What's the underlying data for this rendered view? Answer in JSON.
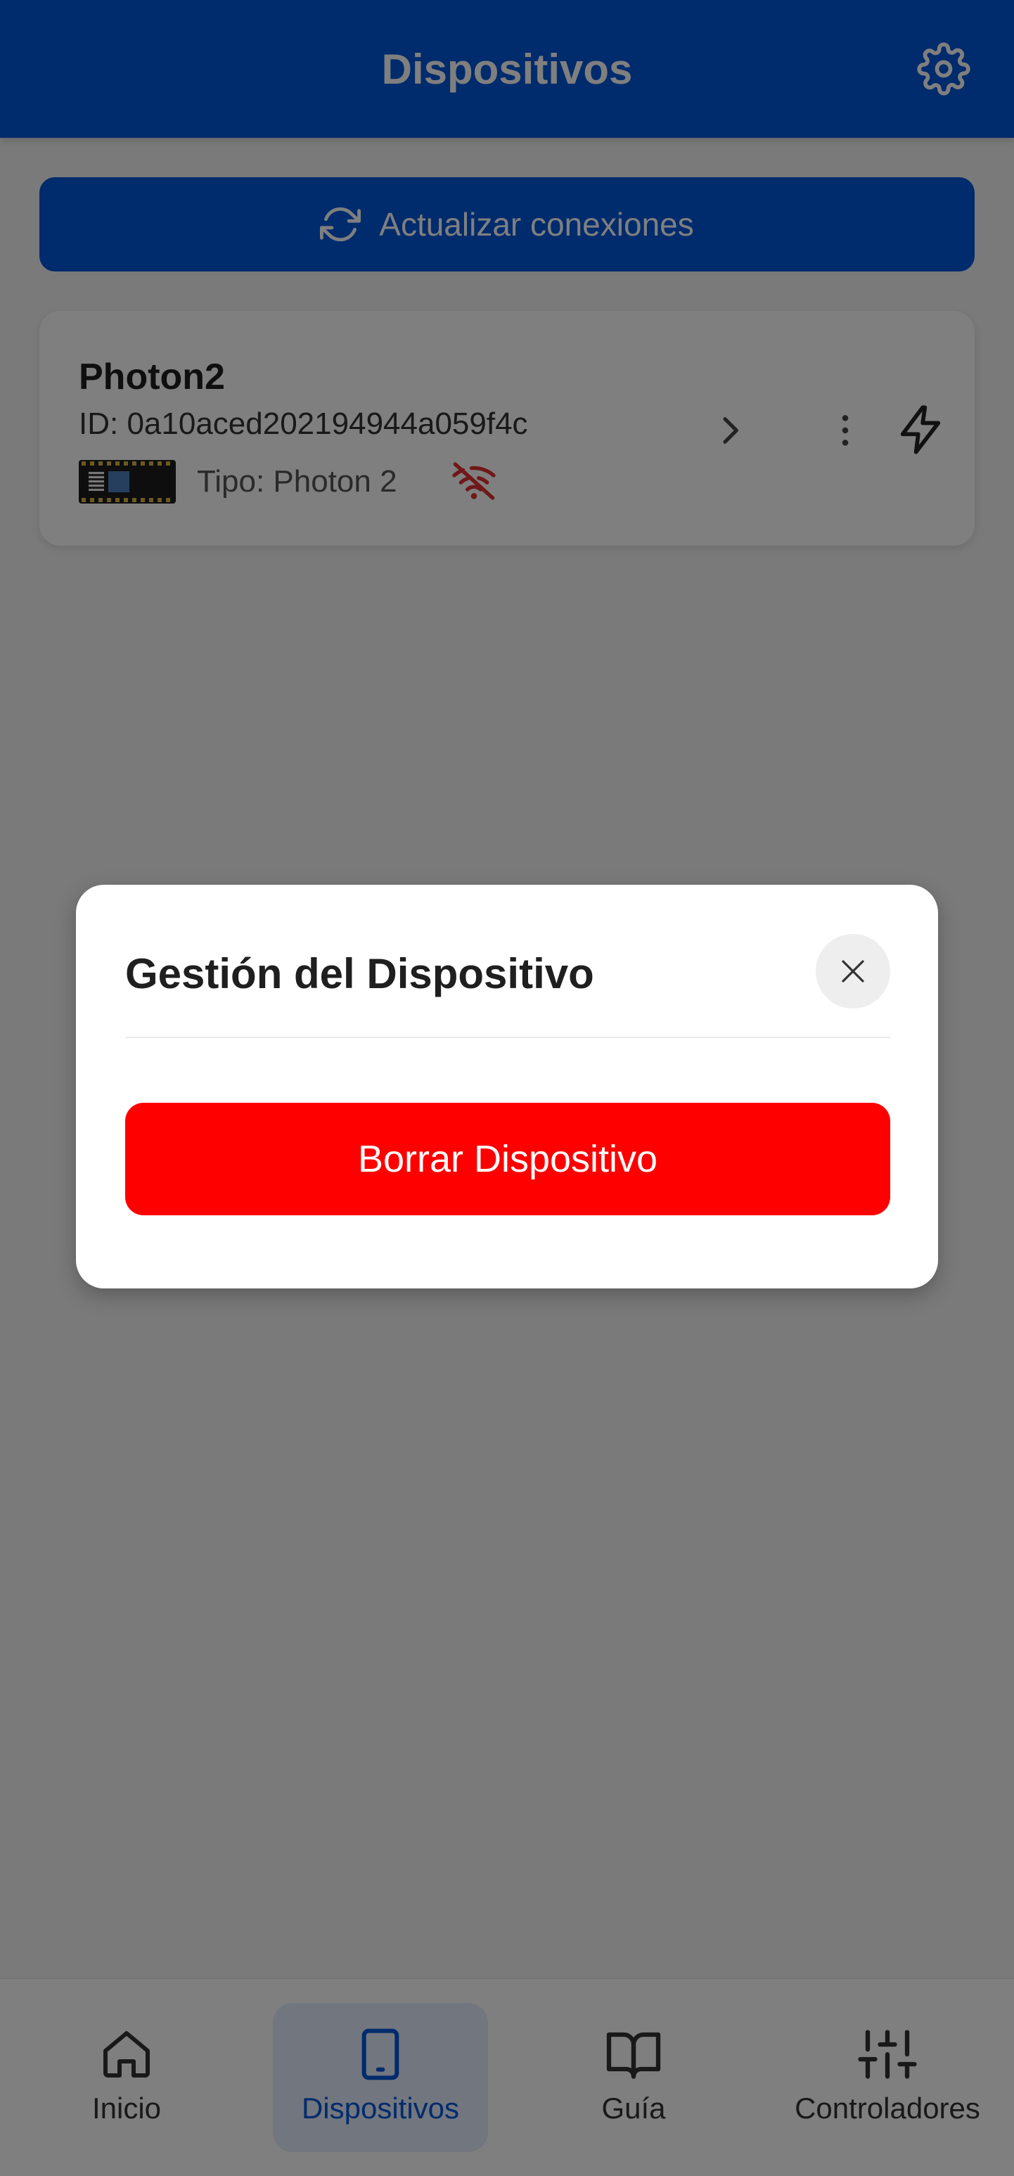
{
  "header": {
    "title": "Dispositivos",
    "settings_icon": "gear-icon"
  },
  "refresh_button": {
    "label": "Actualizar conexiones",
    "icon": "refresh-icon"
  },
  "device": {
    "name": "Photon2",
    "id_text": "ID: 0a10aced202194944a059f4c",
    "type_text": "Tipo: Photon 2",
    "connection_status_icon": "wifi-off-icon"
  },
  "modal": {
    "title": "Gestión del Dispositivo",
    "delete_label": "Borrar Dispositivo"
  },
  "nav": {
    "items": [
      {
        "label": "Inicio",
        "icon": "home-icon"
      },
      {
        "label": "Dispositivos",
        "icon": "tablet-icon",
        "active": true
      },
      {
        "label": "Guía",
        "icon": "book-icon"
      },
      {
        "label": "Controladores",
        "icon": "sliders-icon"
      }
    ]
  },
  "colors": {
    "primary": "#0057d9",
    "danger": "#ff0000",
    "offline": "#e03030",
    "overlay": "rgba(0,0,0,0.5)"
  }
}
